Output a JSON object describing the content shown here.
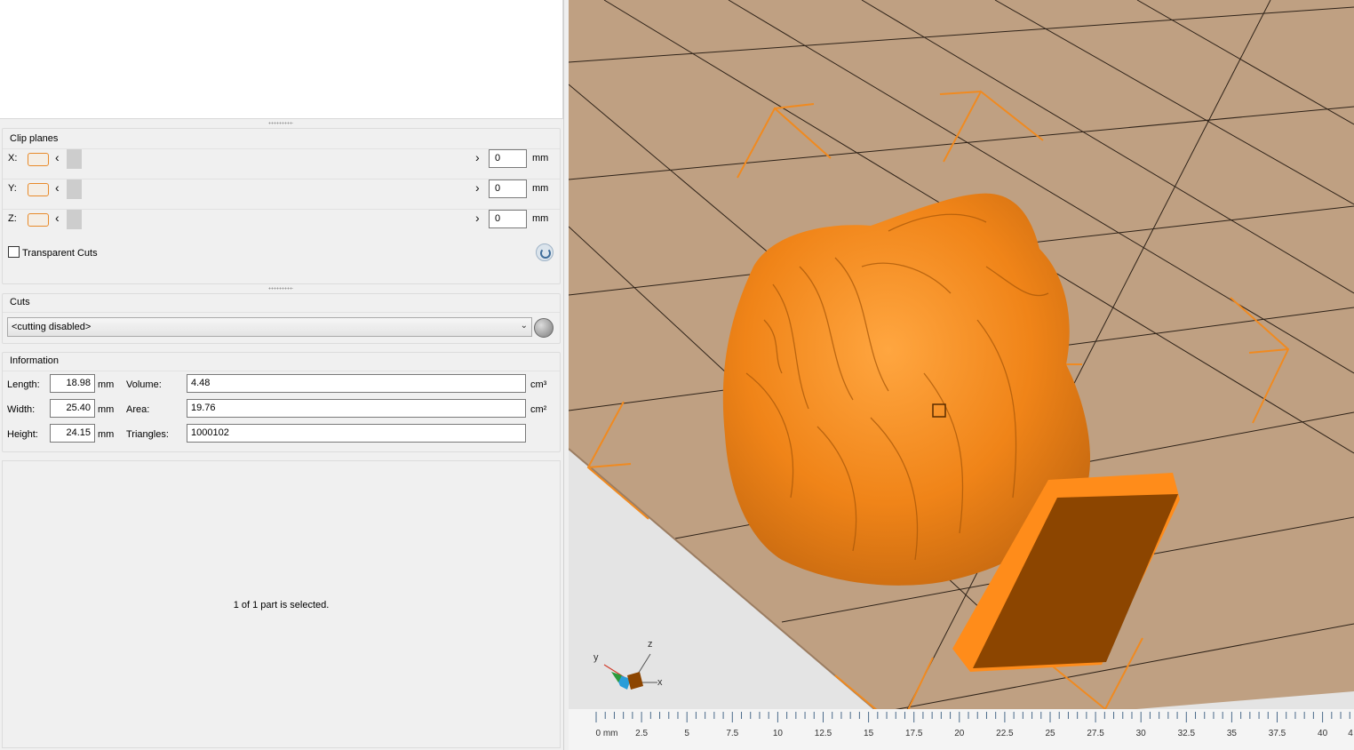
{
  "clip_planes": {
    "title": "Clip planes",
    "rows": [
      {
        "axis": "X:",
        "value": "0",
        "unit": "mm"
      },
      {
        "axis": "Y:",
        "value": "0",
        "unit": "mm"
      },
      {
        "axis": "Z:",
        "value": "0",
        "unit": "mm"
      }
    ],
    "transparent_cuts_label": "Transparent Cuts",
    "transparent_cuts_checked": false
  },
  "cuts": {
    "title": "Cuts",
    "selected": "<cutting disabled>"
  },
  "information": {
    "title": "Information",
    "length_label": "Length:",
    "length_value": "18.98",
    "length_unit": "mm",
    "width_label": "Width:",
    "width_value": "25.40",
    "width_unit": "mm",
    "height_label": "Height:",
    "height_value": "24.15",
    "height_unit": "mm",
    "volume_label": "Volume:",
    "volume_value": "4.48",
    "volume_unit": "cm³",
    "area_label": "Area:",
    "area_value": "19.76",
    "area_unit": "cm²",
    "triangles_label": "Triangles:",
    "triangles_value": "1000102"
  },
  "status": {
    "text": "1 of 1 part is selected."
  },
  "viewport": {
    "model_color": "#ff8c1a",
    "plate_color": "#bfa082",
    "axes": {
      "x": "x",
      "y": "y",
      "z": "z"
    },
    "ruler_labels": [
      "0 mm",
      "2.5",
      "5",
      "7.5",
      "10",
      "12.5",
      "15",
      "17.5",
      "20",
      "22.5",
      "25",
      "27.5",
      "30",
      "32.5",
      "35",
      "37.5",
      "40",
      "4"
    ]
  }
}
